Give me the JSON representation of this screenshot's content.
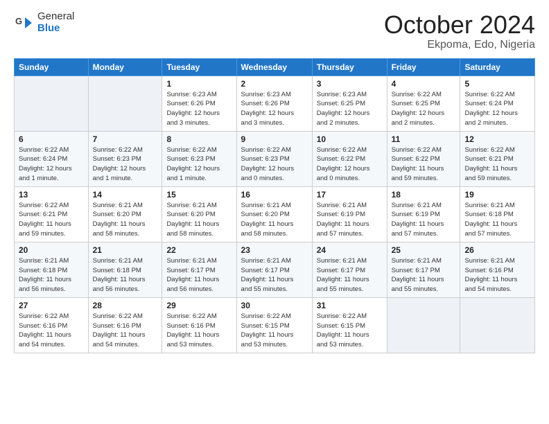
{
  "header": {
    "logo_general": "General",
    "logo_blue": "Blue",
    "month": "October 2024",
    "location": "Ekpoma, Edo, Nigeria"
  },
  "days_of_week": [
    "Sunday",
    "Monday",
    "Tuesday",
    "Wednesday",
    "Thursday",
    "Friday",
    "Saturday"
  ],
  "weeks": [
    [
      {
        "day": "",
        "info": ""
      },
      {
        "day": "",
        "info": ""
      },
      {
        "day": "1",
        "info": "Sunrise: 6:23 AM\nSunset: 6:26 PM\nDaylight: 12 hours\nand 3 minutes."
      },
      {
        "day": "2",
        "info": "Sunrise: 6:23 AM\nSunset: 6:26 PM\nDaylight: 12 hours\nand 3 minutes."
      },
      {
        "day": "3",
        "info": "Sunrise: 6:23 AM\nSunset: 6:25 PM\nDaylight: 12 hours\nand 2 minutes."
      },
      {
        "day": "4",
        "info": "Sunrise: 6:22 AM\nSunset: 6:25 PM\nDaylight: 12 hours\nand 2 minutes."
      },
      {
        "day": "5",
        "info": "Sunrise: 6:22 AM\nSunset: 6:24 PM\nDaylight: 12 hours\nand 2 minutes."
      }
    ],
    [
      {
        "day": "6",
        "info": "Sunrise: 6:22 AM\nSunset: 6:24 PM\nDaylight: 12 hours\nand 1 minute."
      },
      {
        "day": "7",
        "info": "Sunrise: 6:22 AM\nSunset: 6:23 PM\nDaylight: 12 hours\nand 1 minute."
      },
      {
        "day": "8",
        "info": "Sunrise: 6:22 AM\nSunset: 6:23 PM\nDaylight: 12 hours\nand 1 minute."
      },
      {
        "day": "9",
        "info": "Sunrise: 6:22 AM\nSunset: 6:23 PM\nDaylight: 12 hours\nand 0 minutes."
      },
      {
        "day": "10",
        "info": "Sunrise: 6:22 AM\nSunset: 6:22 PM\nDaylight: 12 hours\nand 0 minutes."
      },
      {
        "day": "11",
        "info": "Sunrise: 6:22 AM\nSunset: 6:22 PM\nDaylight: 11 hours\nand 59 minutes."
      },
      {
        "day": "12",
        "info": "Sunrise: 6:22 AM\nSunset: 6:21 PM\nDaylight: 11 hours\nand 59 minutes."
      }
    ],
    [
      {
        "day": "13",
        "info": "Sunrise: 6:22 AM\nSunset: 6:21 PM\nDaylight: 11 hours\nand 59 minutes."
      },
      {
        "day": "14",
        "info": "Sunrise: 6:21 AM\nSunset: 6:20 PM\nDaylight: 11 hours\nand 58 minutes."
      },
      {
        "day": "15",
        "info": "Sunrise: 6:21 AM\nSunset: 6:20 PM\nDaylight: 11 hours\nand 58 minutes."
      },
      {
        "day": "16",
        "info": "Sunrise: 6:21 AM\nSunset: 6:20 PM\nDaylight: 11 hours\nand 58 minutes."
      },
      {
        "day": "17",
        "info": "Sunrise: 6:21 AM\nSunset: 6:19 PM\nDaylight: 11 hours\nand 57 minutes."
      },
      {
        "day": "18",
        "info": "Sunrise: 6:21 AM\nSunset: 6:19 PM\nDaylight: 11 hours\nand 57 minutes."
      },
      {
        "day": "19",
        "info": "Sunrise: 6:21 AM\nSunset: 6:18 PM\nDaylight: 11 hours\nand 57 minutes."
      }
    ],
    [
      {
        "day": "20",
        "info": "Sunrise: 6:21 AM\nSunset: 6:18 PM\nDaylight: 11 hours\nand 56 minutes."
      },
      {
        "day": "21",
        "info": "Sunrise: 6:21 AM\nSunset: 6:18 PM\nDaylight: 11 hours\nand 56 minutes."
      },
      {
        "day": "22",
        "info": "Sunrise: 6:21 AM\nSunset: 6:17 PM\nDaylight: 11 hours\nand 56 minutes."
      },
      {
        "day": "23",
        "info": "Sunrise: 6:21 AM\nSunset: 6:17 PM\nDaylight: 11 hours\nand 55 minutes."
      },
      {
        "day": "24",
        "info": "Sunrise: 6:21 AM\nSunset: 6:17 PM\nDaylight: 11 hours\nand 55 minutes."
      },
      {
        "day": "25",
        "info": "Sunrise: 6:21 AM\nSunset: 6:17 PM\nDaylight: 11 hours\nand 55 minutes."
      },
      {
        "day": "26",
        "info": "Sunrise: 6:21 AM\nSunset: 6:16 PM\nDaylight: 11 hours\nand 54 minutes."
      }
    ],
    [
      {
        "day": "27",
        "info": "Sunrise: 6:22 AM\nSunset: 6:16 PM\nDaylight: 11 hours\nand 54 minutes."
      },
      {
        "day": "28",
        "info": "Sunrise: 6:22 AM\nSunset: 6:16 PM\nDaylight: 11 hours\nand 54 minutes."
      },
      {
        "day": "29",
        "info": "Sunrise: 6:22 AM\nSunset: 6:16 PM\nDaylight: 11 hours\nand 53 minutes."
      },
      {
        "day": "30",
        "info": "Sunrise: 6:22 AM\nSunset: 6:15 PM\nDaylight: 11 hours\nand 53 minutes."
      },
      {
        "day": "31",
        "info": "Sunrise: 6:22 AM\nSunset: 6:15 PM\nDaylight: 11 hours\nand 53 minutes."
      },
      {
        "day": "",
        "info": ""
      },
      {
        "day": "",
        "info": ""
      }
    ]
  ]
}
